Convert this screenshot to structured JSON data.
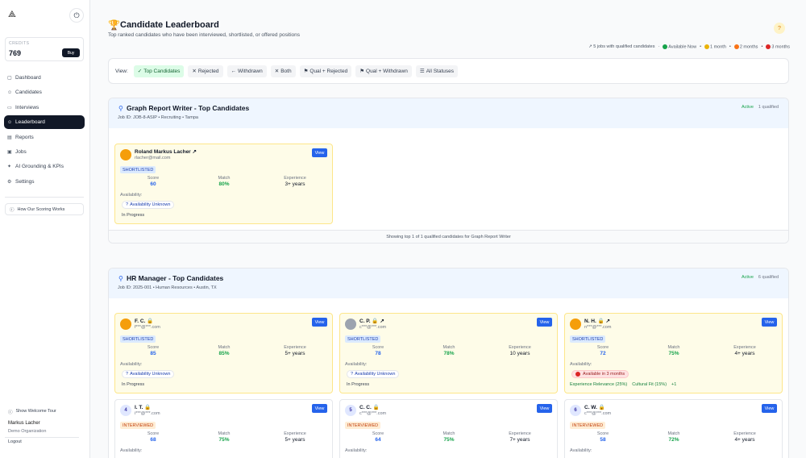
{
  "sidebar": {
    "logo": "⟁",
    "credits_label": "CREDITS",
    "credits_value": "769",
    "buy_label": "Buy",
    "nav": [
      {
        "label": "Dashboard",
        "icon": "▢"
      },
      {
        "label": "Candidates",
        "icon": "☺"
      },
      {
        "label": "Interviews",
        "icon": "▭"
      },
      {
        "label": "Leaderboard",
        "icon": "☺"
      },
      {
        "label": "Reports",
        "icon": "▤"
      },
      {
        "label": "Jobs",
        "icon": "▣"
      },
      {
        "label": "AI Grounding & KPIs",
        "icon": "✦"
      },
      {
        "label": "Settings",
        "icon": "⚙"
      }
    ],
    "scoring_label": "How Our Scoring Works",
    "tour_label": "Show Welcome Tour",
    "user_name": "Markus Lacher",
    "user_org": "Demo Organization",
    "logout_label": "Logout"
  },
  "header": {
    "title": "Candidate Leaderboard",
    "subtitle": "Top ranked candidates who have been interviewed, shortlisted, or offered positions",
    "help": "?",
    "legend_jobs": "↗ 5 jobs with qualified candidates",
    "legend_items": [
      {
        "label": "Available Now",
        "color": "#16a34a"
      },
      {
        "label": "1 month",
        "color": "#eab308"
      },
      {
        "label": "2 months",
        "color": "#f97316"
      },
      {
        "label": "3 months",
        "color": "#dc2626"
      }
    ]
  },
  "filters": {
    "label": "View:",
    "chips": [
      {
        "label": "Top Candidates",
        "icon": "✓"
      },
      {
        "label": "Rejected",
        "icon": "✕"
      },
      {
        "label": "Withdrawn",
        "icon": "←"
      },
      {
        "label": "Both",
        "icon": "✕"
      },
      {
        "label": "Qual + Rejected",
        "icon": "⚑"
      },
      {
        "label": "Qual + Withdrawn",
        "icon": "⚑"
      },
      {
        "label": "All Statuses",
        "icon": "☰"
      }
    ]
  },
  "sections": [
    {
      "title": "Graph Report Writer - Top Candidates",
      "sub": "Job ID: JOB-8-ASIP • Recruiting • Tampa",
      "status": "Active",
      "count": "1 qualified",
      "footer": "Showing top 1 of 1 qualified candidates for Graph Report Writer",
      "cards": [
        {
          "name": "Roland Markus Lacher ↗",
          "email": "rlacher@mail.com",
          "status": "SHORTLISTED",
          "score": "60",
          "match": "80%",
          "experience": "3+ years",
          "avail": "Availability Unknown",
          "progress": "In Progress"
        }
      ]
    },
    {
      "title": "HR Manager - Top Candidates",
      "sub": "Job ID: 2025-001 • Human Resources • Austin, TX",
      "status": "Active",
      "count": "6 qualified",
      "cards": [
        {
          "name": "F. C. 🔒",
          "email": "f***@***.com",
          "status": "SHORTLISTED",
          "score": "85",
          "match": "85%",
          "experience": "5+ years",
          "avail": "Availability Unknown",
          "progress": "In Progress"
        },
        {
          "name": "C. P. 🔒 ↗",
          "email": "c***@***.com",
          "status": "SHORTLISTED",
          "score": "78",
          "match": "78%",
          "experience": "10 years",
          "avail": "Availability Unknown",
          "progress": "In Progress"
        },
        {
          "name": "N. H. 🔒 ↗",
          "email": "n***@***.com",
          "status": "SHORTLISTED",
          "score": "72",
          "match": "75%",
          "experience": "4+ years",
          "avail": "Available in 3 months",
          "tags": [
            "Experience Relevance (25%)",
            "Cultural Fit (15%)",
            "+1"
          ]
        },
        {
          "rank": "4",
          "name": "I. T. 🔒",
          "email": "i***@***.com",
          "status": "INTERVIEWED",
          "score": "68",
          "match": "75%",
          "experience": "5+ years"
        },
        {
          "rank": "5",
          "name": "C. C. 🔒",
          "email": "c***@***.com",
          "status": "INTERVIEWED",
          "score": "64",
          "match": "75%",
          "experience": "7+ years"
        },
        {
          "rank": "6",
          "name": "C. W. 🔒",
          "email": "c***@***.com",
          "status": "INTERVIEWED",
          "score": "58",
          "match": "72%",
          "experience": "4+ years"
        }
      ]
    }
  ],
  "labels": {
    "view": "View",
    "score": "Score",
    "match": "Match",
    "experience": "Experience",
    "availability": "Availability:"
  }
}
